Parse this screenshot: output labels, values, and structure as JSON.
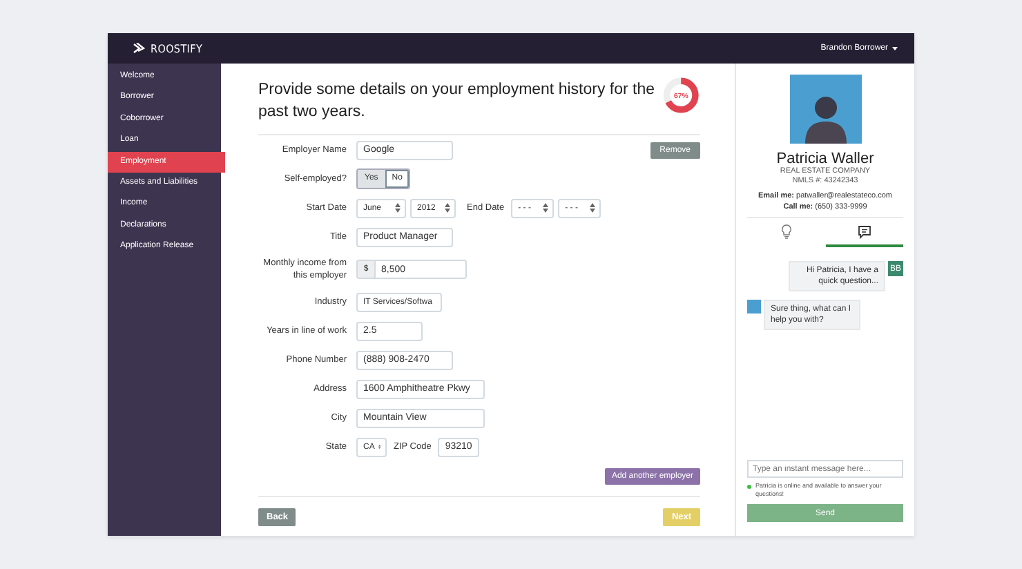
{
  "topbar": {
    "brand": "ROOSTIFY",
    "user_menu": "Brandon Borrower"
  },
  "sidebar": {
    "items": [
      {
        "label": "Welcome",
        "selected": false
      },
      {
        "label": "Borrower",
        "selected": false
      },
      {
        "label": "Coborrower",
        "selected": false
      },
      {
        "label": "Loan",
        "selected": false
      },
      {
        "label": "Employment",
        "selected": true
      },
      {
        "label": "Assets and Liabilities",
        "selected": false
      },
      {
        "label": "Income",
        "selected": false
      },
      {
        "label": "Declarations",
        "selected": false
      },
      {
        "label": "Application Release",
        "selected": false
      }
    ]
  },
  "heading": "Provide some details on your employment history for the past two years.",
  "progress": {
    "level": 0.67,
    "label": "67%"
  },
  "form": {
    "remove_button": "Remove",
    "fields": [
      {
        "kind": "text",
        "label": "Employer Name",
        "value": "Google"
      },
      {
        "kind": "toggle",
        "label": "Self-employed?",
        "options": [
          {
            "label": "Yes",
            "selected": false
          },
          {
            "label": "No",
            "selected": true
          }
        ]
      },
      {
        "kind": "dates",
        "label": "Start Date",
        "values": [
          "June",
          "2012"
        ],
        "label_2": "End Date",
        "values_2": [
          "- - -",
          "- - -"
        ]
      },
      {
        "kind": "text",
        "label": "Title",
        "value": "Product Manager"
      },
      {
        "kind": "currency",
        "label": "Monthly income from this employer",
        "prefix": "$",
        "value": "8,500"
      },
      {
        "kind": "select",
        "label": "Industry",
        "value": "IT Services/Softwa"
      },
      {
        "kind": "text",
        "label": "Years in line of work",
        "value": "2.5"
      },
      {
        "kind": "text",
        "label": "Phone Number",
        "value": "(888) 908-2470"
      },
      {
        "kind": "text",
        "label": "Address",
        "value": "1600 Amphitheatre Pkwy"
      },
      {
        "kind": "text",
        "label": "City",
        "value": "Mountain View"
      },
      {
        "kind": "state_zip",
        "label": "State",
        "value": "CA",
        "label_2": "ZIP Code",
        "value_2": "93210"
      }
    ],
    "add_button": "Add another employer",
    "back_button": "Back",
    "next_button": "Next"
  },
  "agent": {
    "name": "Patricia Waller",
    "company": "REAL ESTATE COMPANY",
    "nmls": "NMLS #: 43242343",
    "email": "**Email me:** patwaller@realestateco.com",
    "phone": "**Call me:** (650) 333-9999"
  },
  "chat": {
    "tabs": [
      {
        "kind": "bulb",
        "selected": false
      },
      {
        "kind": "chat",
        "selected": true
      }
    ],
    "messages": [
      {
        "kind": "user",
        "initials": "BB",
        "text": "Hi Patricia, I have a quick question..."
      },
      {
        "kind": "agent",
        "text": "Sure thing, what can I help you with?"
      }
    ],
    "placeholder": "Type an instant message here...",
    "status": {
      "online": true,
      "text": "Patricia is online and available to answer your questions!"
    },
    "send_button": "Send"
  }
}
